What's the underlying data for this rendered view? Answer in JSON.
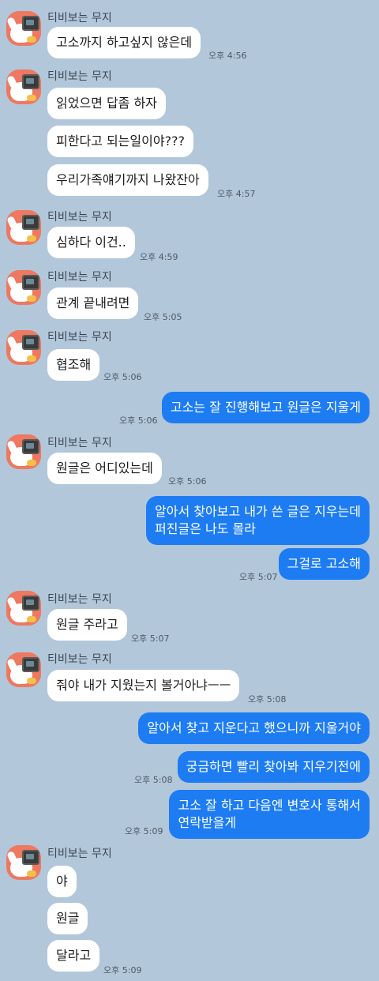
{
  "contact_name": "티비보는 무지",
  "theme": {
    "background": "#b2c7da",
    "incoming_bubble": "#ffffff",
    "outgoing_bubble": "#1d7cf2",
    "avatar_bg": "#ee7860"
  },
  "messages": [
    {
      "text": "고소까지 하고싶지 않은데",
      "time": "오후 4:56"
    },
    {
      "text": "읽었으면 답좀 하자"
    },
    {
      "text": "피한다고 되는일이야???"
    },
    {
      "text": "우리가족얘기까지 나왔잔아",
      "time": "오후 4:57"
    },
    {
      "text": "심하다 이건..",
      "time": "오후 4:59"
    },
    {
      "text": "관계 끝내려면",
      "time": "오후 5:05"
    },
    {
      "text": "협조해",
      "time": "오후 5:06"
    },
    {
      "text": "고소는 잘 진행해보고 원글은 지울게",
      "time": "오후 5:06"
    },
    {
      "text": "원글은 어디있는데",
      "time": "오후 5:06"
    },
    {
      "line1": "알아서 찾아보고 내가 쓴 글은 지우는데",
      "line2": "퍼진글은 나도 몰라"
    },
    {
      "text": "그걸로 고소해",
      "time": "오후 5:07"
    },
    {
      "text": "원글 주라고",
      "time": "오후 5:07"
    },
    {
      "text": "줘야 내가 지웠는지 볼거아냐ㅡㅡ",
      "time": "오후 5:08"
    },
    {
      "text": "알아서 찾고 지운다고 했으니까 지울거야"
    },
    {
      "text": "궁금하면 빨리 찾아봐 지우기전에",
      "time": "오후 5:08"
    },
    {
      "line1": "고소 잘 하고 다음엔 변호사 통해서",
      "line2": "연락받을게",
      "time": "오후 5:09"
    },
    {
      "text": "야"
    },
    {
      "text": "원글"
    },
    {
      "text": "달라고",
      "time": "오후 5:09"
    }
  ]
}
